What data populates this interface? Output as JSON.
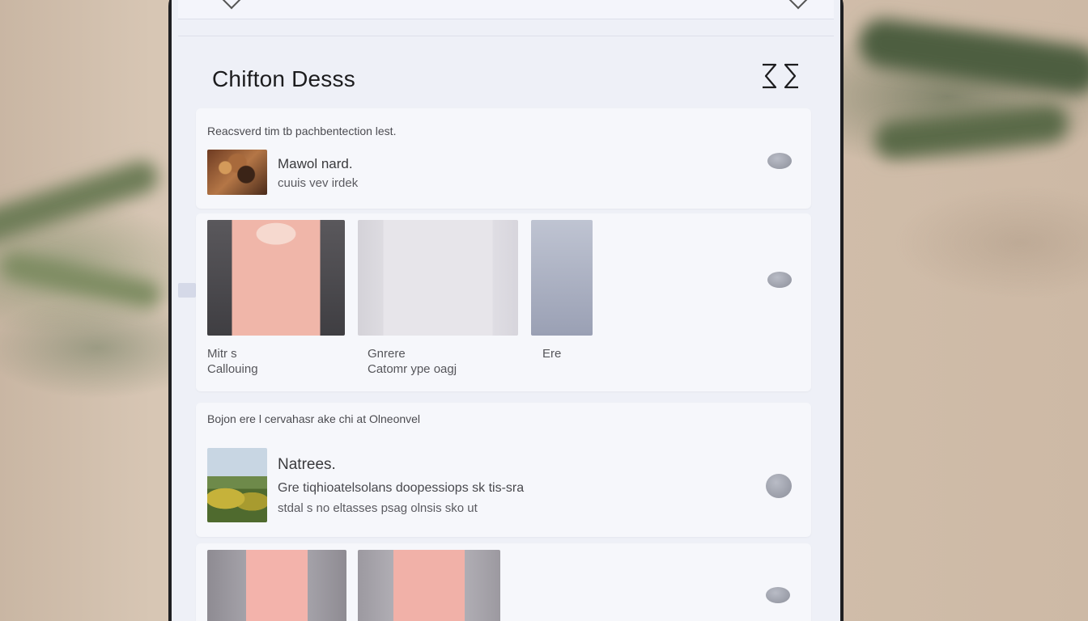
{
  "header": {
    "title": "Chifton Desss"
  },
  "cards": {
    "c1": {
      "header": "Reacsverd tim tb pachbentection lest.",
      "item_title": "Mawol nard.",
      "item_sub": "cuuis vev irdek"
    },
    "c2": {
      "captions": [
        {
          "line1": "Mitr s",
          "line2": "Callouing"
        },
        {
          "line1": "Gnrere",
          "line2": "Catomr ype oagj"
        },
        {
          "line1": "Ere",
          "line2": ""
        }
      ]
    },
    "c3": {
      "header": "Bojon ere l  cervahasr ake chi at Olneonvel",
      "item_title": "Natrees.",
      "item_line1": "Gre tiqhioatelsolans doopessiops sk tis-sra",
      "item_line2": "stdal s no  eltasses psag olnsis sko ut"
    }
  },
  "icons": {
    "expand": "expand-arrows-icon",
    "action": "ellipse-action-icon"
  },
  "colors": {
    "screen_bg": "#eef0f7",
    "card_bg": "#f6f7fb",
    "dress_pink": "#f1b1a8"
  }
}
